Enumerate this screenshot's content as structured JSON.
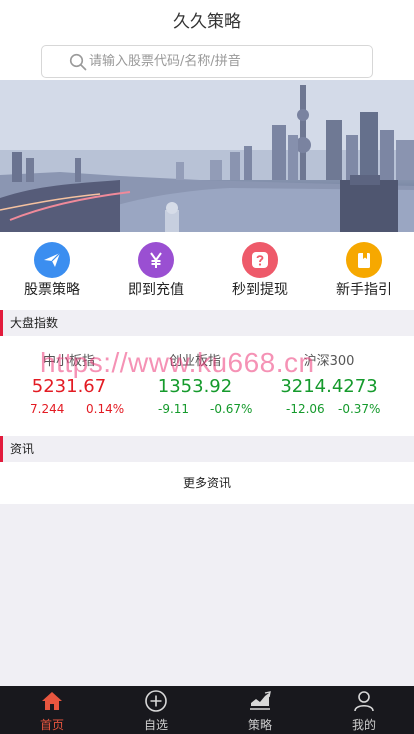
{
  "header": {
    "title": "久久策略"
  },
  "search": {
    "placeholder": "请输入股票代码/名称/拼音"
  },
  "quick_links": [
    {
      "label": "股票策略",
      "icon": "paper-plane-icon",
      "color": "#3b8ef0"
    },
    {
      "label": "即到充值",
      "icon": "yen-icon",
      "color": "#9a4fd2"
    },
    {
      "label": "秒到提现",
      "icon": "question-icon",
      "color": "#ee5a6a"
    },
    {
      "label": "新手指引",
      "icon": "book-icon",
      "color": "#f6a800"
    }
  ],
  "market": {
    "section_title": "大盘指数",
    "indices": [
      {
        "name": "中小板指",
        "price": "5231.67",
        "change": "7.244",
        "percent": "0.14%",
        "trend": "up"
      },
      {
        "name": "创业板指",
        "price": "1353.92",
        "change": "-9.11",
        "percent": "-0.67%",
        "trend": "down"
      },
      {
        "name": "沪深300",
        "price": "3214.4273",
        "change": "-12.06",
        "percent": "-0.37%",
        "trend": "down"
      }
    ]
  },
  "news": {
    "section_title": "资讯",
    "more_label": "更多资讯"
  },
  "watermark": "https://www.ku668.cn",
  "tabbar": [
    {
      "label": "首页",
      "icon": "home-icon",
      "active": true
    },
    {
      "label": "自选",
      "icon": "plus-circle-icon",
      "active": false
    },
    {
      "label": "策略",
      "icon": "chart-icon",
      "active": false
    },
    {
      "label": "我的",
      "icon": "user-icon",
      "active": false
    }
  ],
  "colors": {
    "accent": "#e21b3c",
    "up": "#e31b23",
    "down": "#159a2c",
    "tab_active": "#e8563f"
  }
}
